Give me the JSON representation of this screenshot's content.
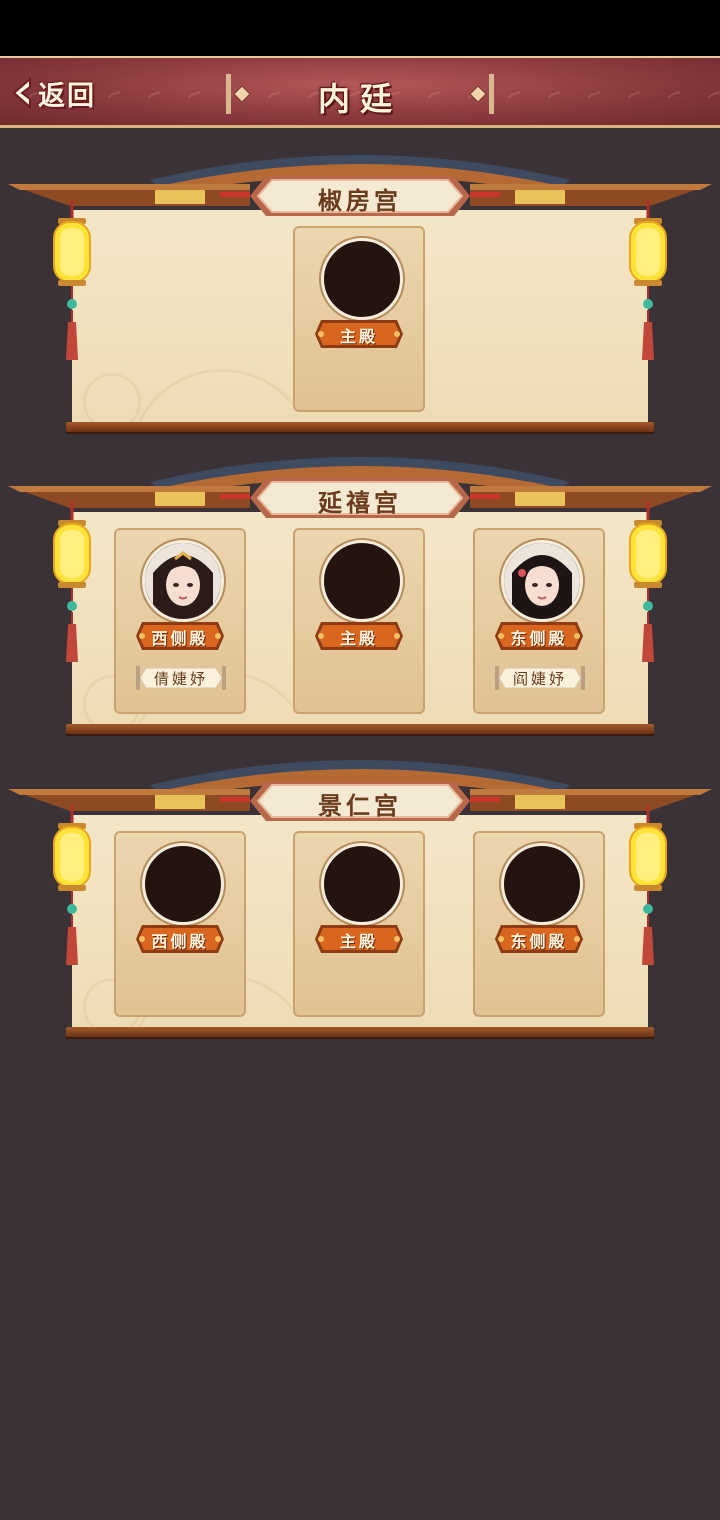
{
  "header": {
    "back_label": "返回",
    "title": "内廷"
  },
  "palaces": [
    {
      "name": "椒房宫",
      "halls": [
        {
          "hall": "主殿",
          "occupied": false,
          "rank": ""
        }
      ]
    },
    {
      "name": "延禧宫",
      "halls": [
        {
          "hall": "西侧殿",
          "occupied": true,
          "rank": "倩婕妤"
        },
        {
          "hall": "主殿",
          "occupied": false,
          "rank": ""
        },
        {
          "hall": "东侧殿",
          "occupied": true,
          "rank": "阎婕妤"
        }
      ]
    },
    {
      "name": "景仁宫",
      "halls": [
        {
          "hall": "西侧殿",
          "occupied": false,
          "rank": ""
        },
        {
          "hall": "主殿",
          "occupied": false,
          "rank": ""
        },
        {
          "hall": "东侧殿",
          "occupied": false,
          "rank": ""
        }
      ]
    }
  ],
  "colors": {
    "background": "#3a3236",
    "header": "#8c3a3e",
    "panel": "#f3e6c8",
    "hall_tag": "#d9661f",
    "lantern": "#ffe23a"
  },
  "icons": [
    "back-chevron-icon",
    "lantern-icon",
    "portrait-avatar"
  ]
}
